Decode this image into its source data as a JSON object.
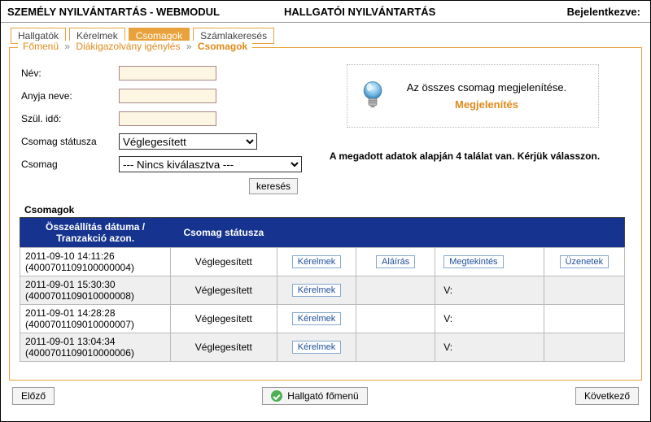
{
  "header": {
    "left": "SZEMÉLY NYILVÁNTARTÁS - WEBMODUL",
    "mid": "HALLGATÓI NYILVÁNTARTÁS",
    "right": "Bejelentkezve:"
  },
  "tabs": [
    "Hallgatók",
    "Kérelmek",
    "Csomagok",
    "Számlakeresés"
  ],
  "active_tab_index": 2,
  "breadcrumb": {
    "a": "Főmenü",
    "b": "Diákigazolvány igénylés",
    "cur": "Csomagok"
  },
  "form": {
    "name_label": "Név:",
    "mother_label": "Anyja neve:",
    "birth_label": "Szül. idő:",
    "status_label": "Csomag státusza",
    "package_label": "Csomag",
    "status_value": "Véglegesített",
    "package_value": "--- Nincs kiválasztva ---",
    "search_btn": "keresés"
  },
  "info": {
    "line1": "Az összes csomag megjelenítése.",
    "link": "Megjelenítés"
  },
  "hits_text": "A megadott adatok alapján 4 találat van. Kérjük válasszon.",
  "table": {
    "title": "Csomagok",
    "head": {
      "c1": "Összeállítás dátuma / Tranzakció azon.",
      "c2": "Csomag státusza"
    },
    "rows": [
      {
        "dt": "2011-09-10 14:11:26",
        "id": "(4000701109100000004)",
        "st": "Véglegesített",
        "req": "Kérelmek",
        "sign": "Aláírás",
        "view": "Megtekintés",
        "msg": "Üzenetek",
        "alt": false
      },
      {
        "dt": "2011-09-01 15:30:30",
        "id": "(4000701109010000008)",
        "st": "Véglegesített",
        "req": "Kérelmek",
        "view": "V:",
        "alt": true
      },
      {
        "dt": "2011-09-01 14:28:28",
        "id": "(4000701109010000007)",
        "st": "Véglegesített",
        "req": "Kérelmek",
        "view": "V:",
        "alt": false
      },
      {
        "dt": "2011-09-01 13:04:34",
        "id": "(4000701109010000006)",
        "st": "Véglegesített",
        "req": "Kérelmek",
        "view": "V:",
        "alt": true
      }
    ]
  },
  "bottom": {
    "prev": "Előző",
    "main": "Hallgató főmenü",
    "next": "Következő"
  }
}
